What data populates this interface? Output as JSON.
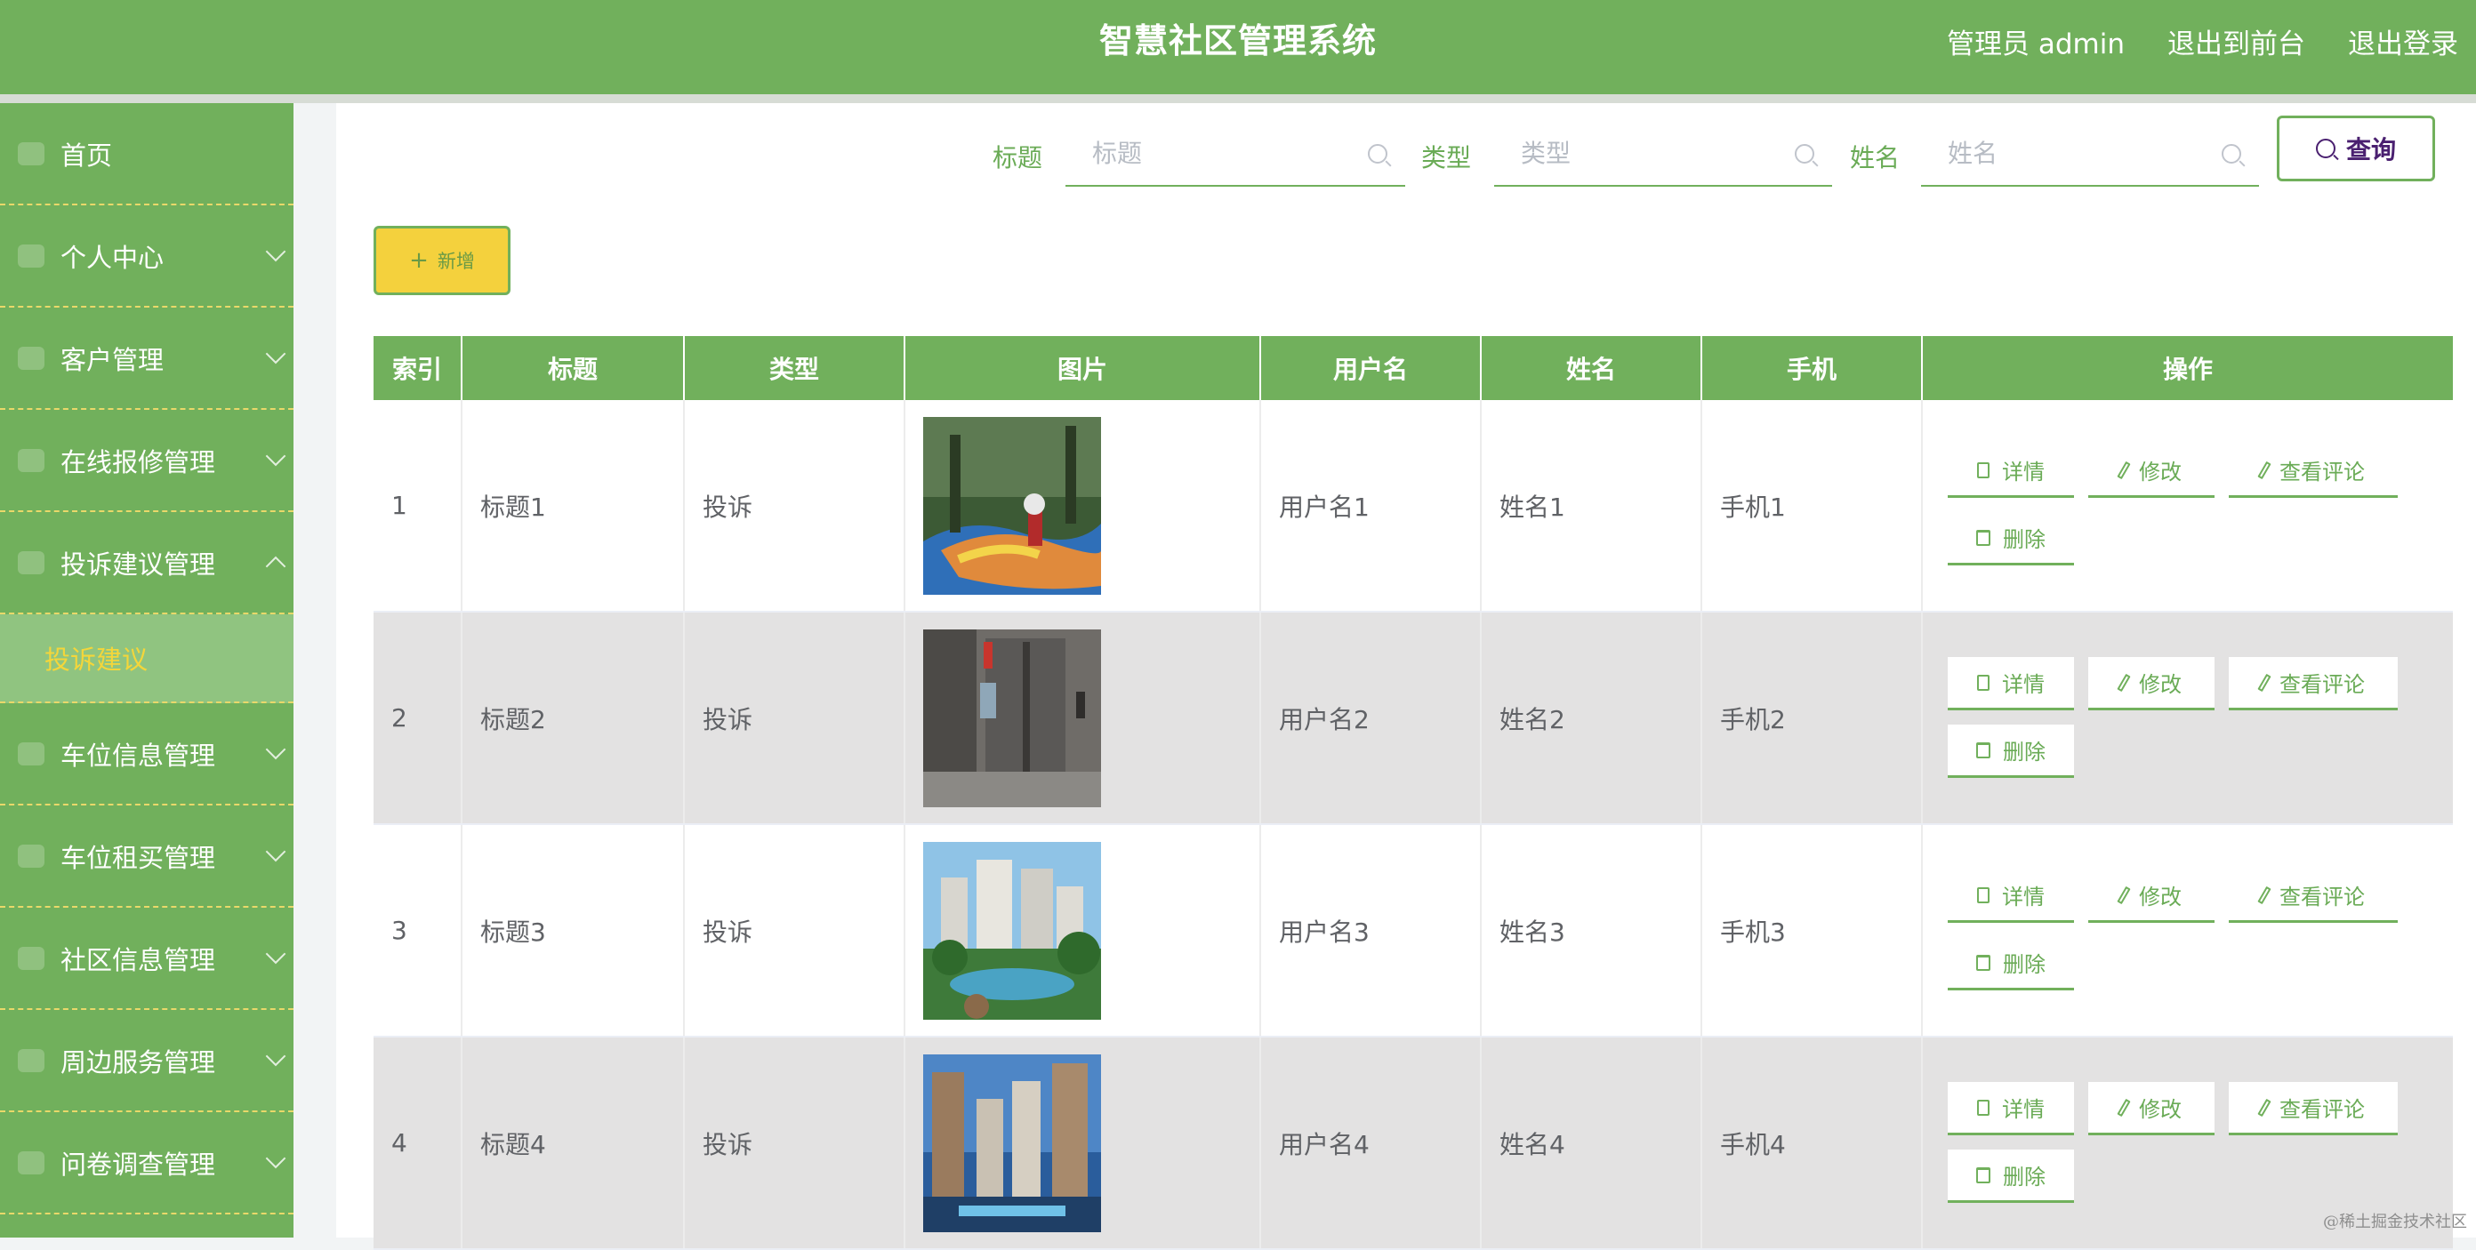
{
  "header": {
    "title": "智慧社区管理系统",
    "admin_label": "管理员 admin",
    "front_link": "退出到前台",
    "logout_link": "退出登录"
  },
  "sidebar": {
    "items": [
      {
        "label": "首页",
        "icon": "home-icon"
      },
      {
        "label": "个人中心",
        "icon": "user-icon",
        "expandable": true
      },
      {
        "label": "客户管理",
        "icon": "customers-icon",
        "expandable": true
      },
      {
        "label": "在线报修管理",
        "icon": "repair-icon",
        "expandable": true
      },
      {
        "label": "投诉建议管理",
        "icon": "complaint-icon",
        "expandable": true,
        "expanded": true
      },
      {
        "label": "车位信息管理",
        "icon": "parking-icon",
        "expandable": true
      },
      {
        "label": "车位租买管理",
        "icon": "parking-rent-icon",
        "expandable": true
      },
      {
        "label": "社区信息管理",
        "icon": "community-icon",
        "expandable": true
      },
      {
        "label": "周边服务管理",
        "icon": "services-icon",
        "expandable": true
      },
      {
        "label": "问卷调查管理",
        "icon": "survey-icon",
        "expandable": true
      }
    ],
    "active_sub": "投诉建议"
  },
  "search": {
    "title_label": "标题",
    "title_placeholder": "标题",
    "type_label": "类型",
    "type_placeholder": "类型",
    "name_label": "姓名",
    "name_placeholder": "姓名",
    "query_button": "查询"
  },
  "actions": {
    "add_button": "新增"
  },
  "table": {
    "columns": [
      "索引",
      "标题",
      "类型",
      "图片",
      "用户名",
      "姓名",
      "手机",
      "操作"
    ],
    "rows": [
      {
        "index": "1",
        "title": "标题1",
        "type": "投诉",
        "username": "用户名1",
        "name": "姓名1",
        "phone": "手机1",
        "image": "playground-photo"
      },
      {
        "index": "2",
        "title": "标题2",
        "type": "投诉",
        "username": "用户名2",
        "name": "姓名2",
        "phone": "手机2",
        "image": "elevator-photo"
      },
      {
        "index": "3",
        "title": "标题3",
        "type": "投诉",
        "username": "用户名3",
        "name": "姓名3",
        "phone": "手机3",
        "image": "garden-building-photo"
      },
      {
        "index": "4",
        "title": "标题4",
        "type": "投诉",
        "username": "用户名4",
        "name": "姓名4",
        "phone": "手机4",
        "image": "highrise-photo"
      }
    ],
    "op_labels": {
      "detail": "详情",
      "edit": "修改",
      "comments": "查看评论",
      "delete": "删除"
    }
  },
  "watermark": "@稀土掘金技术社区",
  "colors": {
    "primary_green": "#71b05c",
    "accent_yellow": "#f4d13d",
    "row_alt": "#e3e2e2",
    "query_text": "#4a2070"
  }
}
